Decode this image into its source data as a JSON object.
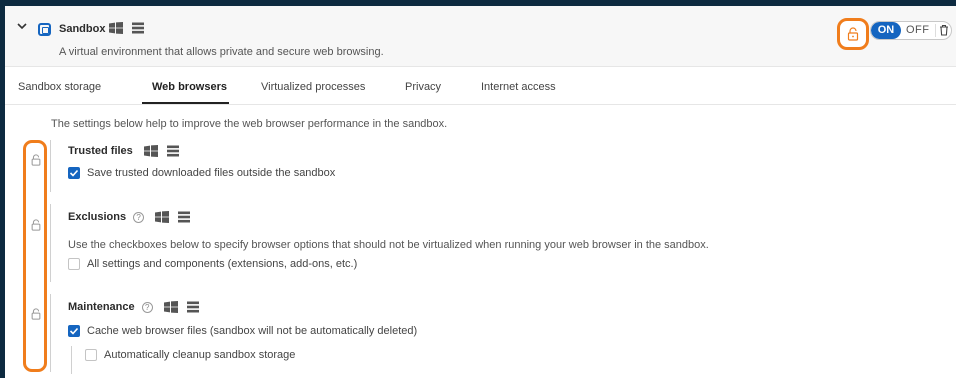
{
  "header": {
    "title": "Sandbox",
    "description": "A virtual environment that allows private and secure web browsing.",
    "toggle_on": "ON",
    "toggle_off": "OFF",
    "accent_color": "#1565c0",
    "highlight_color": "#f07d1c"
  },
  "tabs": [
    {
      "label": "Sandbox storage",
      "active": false
    },
    {
      "label": "Web browsers",
      "active": true
    },
    {
      "label": "Virtualized processes",
      "active": false
    },
    {
      "label": "Privacy",
      "active": false
    },
    {
      "label": "Internet access",
      "active": false
    }
  ],
  "intro": "The settings below help to improve the web browser performance in the sandbox.",
  "sections": {
    "trusted_files": {
      "title": "Trusted files",
      "options": [
        {
          "label": "Save trusted downloaded files outside the sandbox",
          "checked": true
        }
      ]
    },
    "exclusions": {
      "title": "Exclusions",
      "help": "?",
      "note": "Use the checkboxes below to specify browser options that should not be virtualized when running your web browser in the sandbox.",
      "options": [
        {
          "label": "All settings and components (extensions, add-ons, etc.)",
          "checked": false
        }
      ]
    },
    "maintenance": {
      "title": "Maintenance",
      "help": "?",
      "options": [
        {
          "label": "Cache web browser files (sandbox will not be automatically deleted)",
          "checked": true
        },
        {
          "label": "Automatically cleanup sandbox storage",
          "checked": false
        }
      ]
    }
  }
}
